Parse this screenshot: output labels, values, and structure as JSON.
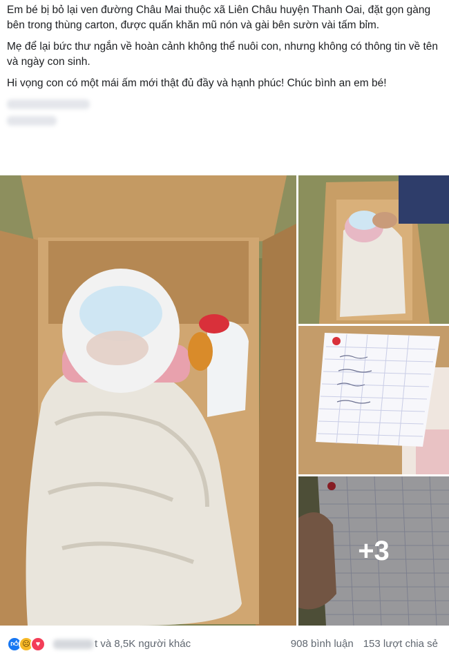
{
  "post": {
    "paragraph_1": "Em bé bị bỏ lại ven đường Châu Mai thuộc xã Liên Châu huyện Thanh Oai, đặt gọn gàng bên trong thùng carton, được quấn khăn mũ nón và gài bên sườn vài tấm bỉm.",
    "paragraph_2": "Mẹ để lại bức thư ngắn về hoàn cảnh không thể nuôi con, nhưng không có thông tin về tên và ngày con sinh.",
    "paragraph_3": "Hi vọng con có một mái ấm mới thật đủ đầy và hạnh phúc! Chúc bình an em bé!"
  },
  "photos": {
    "more_count": "+3"
  },
  "footer": {
    "reaction_icons": [
      "like-icon",
      "sad-icon",
      "love-icon"
    ],
    "reactor_suffix": "t và 8,5K người khác",
    "comments": "908 bình luận",
    "shares": "153 lượt chia sẻ"
  },
  "colors": {
    "like": "#1877f2",
    "sad": "#f7b928",
    "love": "#f33e58",
    "meta_text": "#606770"
  }
}
